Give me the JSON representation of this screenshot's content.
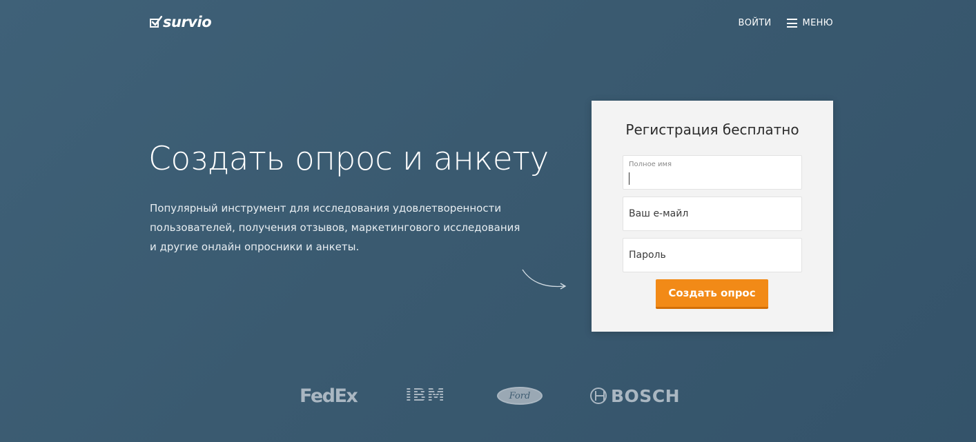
{
  "header": {
    "logo_text": "survio",
    "logo_icon": "checkbox-check-icon",
    "login_label": "ВОЙТИ",
    "menu_label": "МЕНЮ",
    "menu_icon": "hamburger-icon"
  },
  "hero": {
    "title": "Создать опрос и анкету",
    "description": "Популярный инструмент для исследования удовлетворенности пользователей, получения отзывов, маркетингового исследования и другие онлайн опросники и анкеты."
  },
  "signup": {
    "title": "Регистрация бесплатно",
    "fields": [
      {
        "label": "Полное имя",
        "value": "",
        "focused": true
      },
      {
        "placeholder": "Ваш е-майл",
        "value": ""
      },
      {
        "placeholder": "Пароль",
        "value": ""
      }
    ],
    "submit_label": "Создать опрос"
  },
  "client_logos": [
    "FedEx",
    "IBM",
    "Ford",
    "BOSCH"
  ],
  "colors": {
    "background": "#3a5a70",
    "card": "#f3f3f3",
    "accent": "#f28a17",
    "logo_gray": "#aab7c2"
  }
}
